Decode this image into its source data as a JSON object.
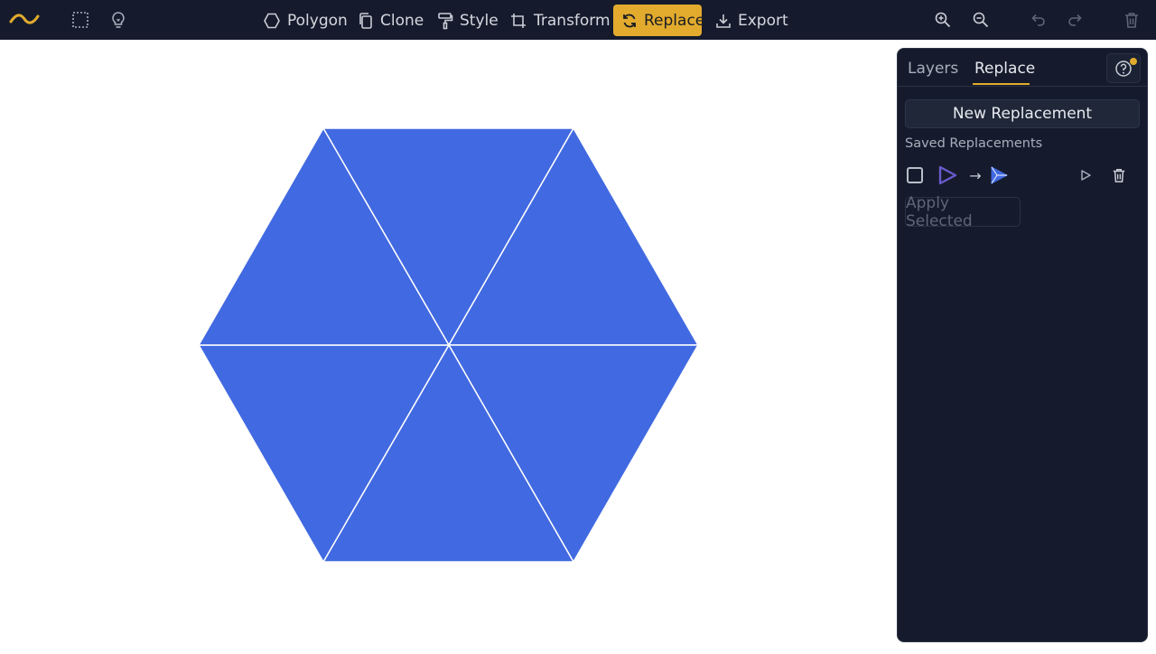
{
  "toolbar": {
    "logo_icon": "wave-logo-icon",
    "select_icon": "dashed-select-icon",
    "hint_icon": "lightbulb-icon",
    "tools": [
      {
        "label": "Polygon",
        "icon": "hexagon-icon"
      },
      {
        "label": "Clone",
        "icon": "clone-icon"
      },
      {
        "label": "Style",
        "icon": "paint-roller-icon"
      },
      {
        "label": "Transform",
        "icon": "transform-icon"
      },
      {
        "label": "Replace",
        "icon": "replace-icon",
        "active": true
      },
      {
        "label": "Export",
        "icon": "download-icon"
      }
    ],
    "right_icons": [
      "zoom-in-icon",
      "zoom-out-icon",
      "undo-icon",
      "redo-icon",
      "trash-icon"
    ],
    "accent_color": "#e2ab2d",
    "bar_color": "#151b2c"
  },
  "canvas": {
    "shape": "hexagon of six triangles",
    "fill_color": "#4169e1",
    "edge_color": "#ffffff"
  },
  "panel": {
    "tabs": [
      {
        "label": "Layers"
      },
      {
        "label": "Replace",
        "active": true
      }
    ],
    "help_icon": "help-circle-icon",
    "new_button": "New Replacement",
    "saved_label": "Saved Replacements",
    "replacements": [
      {
        "checked": false,
        "from_icon": "triangle-outline-icon",
        "arrow": "→",
        "to_icon": "split-triangle-icon",
        "actions": [
          "play-icon",
          "trash-icon"
        ]
      }
    ],
    "apply_button": "Apply Selected"
  }
}
